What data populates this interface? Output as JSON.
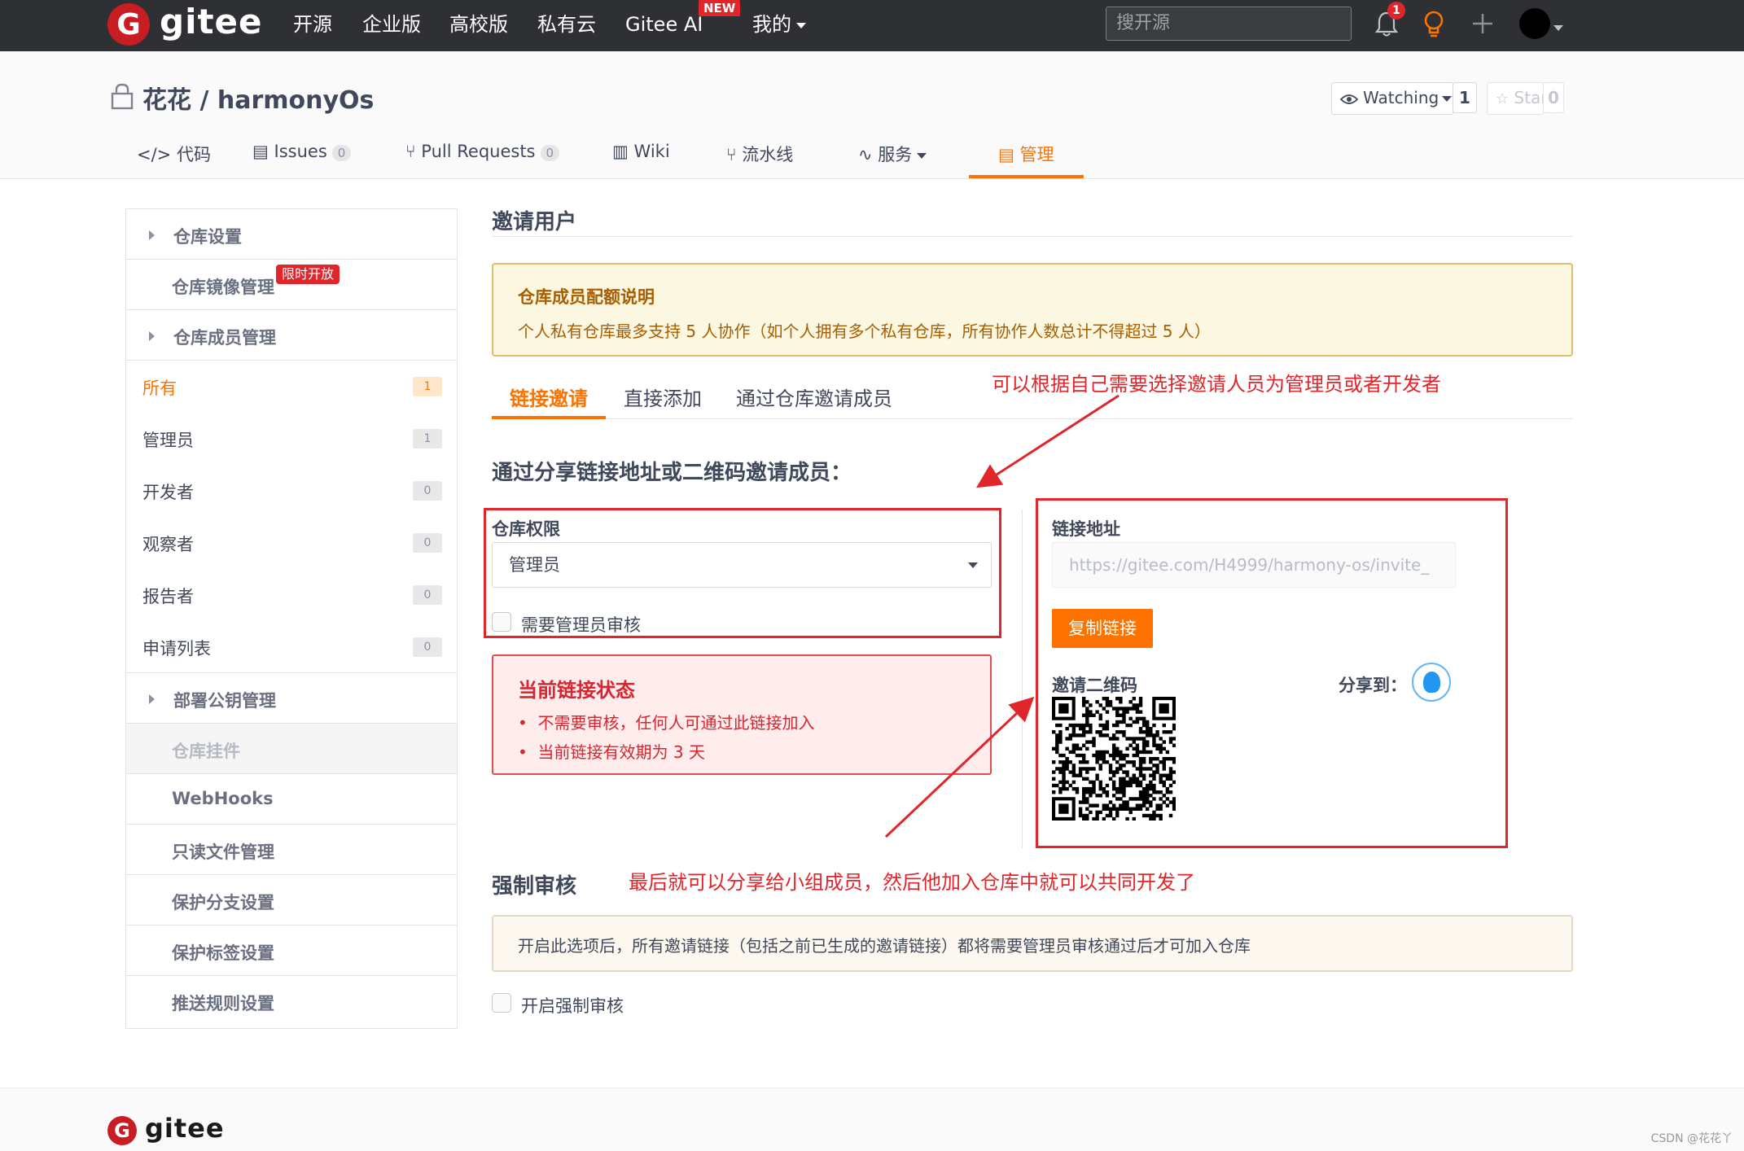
{
  "topnav": {
    "logo_letter": "G",
    "logo_text": "gitee",
    "items": [
      "开源",
      "企业版",
      "高校版",
      "私有云",
      "Gitee AI",
      "我的"
    ],
    "new_badge": "NEW",
    "search_placeholder": "搜开源",
    "notification_count": "1"
  },
  "repo": {
    "title": "花花 / harmonyOs",
    "watching_label": "Watching",
    "watching_count": "1",
    "star_label": "Star",
    "star_count": "0"
  },
  "tabs": [
    {
      "label": "代码"
    },
    {
      "label": "Issues",
      "count": "0"
    },
    {
      "label": "Pull Requests",
      "count": "0"
    },
    {
      "label": "Wiki"
    },
    {
      "label": "流水线"
    },
    {
      "label": "服务"
    },
    {
      "label": "管理"
    }
  ],
  "sidebar": {
    "repo_settings": "仓库设置",
    "mirror_manage": "仓库镜像管理",
    "limited_badge": "限时开放",
    "member_manage": "仓库成员管理",
    "filters": [
      {
        "label": "所有",
        "count": "1"
      },
      {
        "label": "管理员",
        "count": "1"
      },
      {
        "label": "开发者",
        "count": "0"
      },
      {
        "label": "观察者",
        "count": "0"
      },
      {
        "label": "报告者",
        "count": "0"
      },
      {
        "label": "申请列表",
        "count": "0"
      }
    ],
    "deploy_keys": "部署公钥管理",
    "repo_widget": "仓库挂件",
    "webhooks": "WebHooks",
    "readonly_files": "只读文件管理",
    "protected_branch": "保护分支设置",
    "protected_tag": "保护标签设置",
    "push_rules": "推送规则设置"
  },
  "main": {
    "title": "邀请用户",
    "notice_title": "仓库成员配额说明",
    "notice_text": "个人私有仓库最多支持 5 人协作（如个人拥有多个私有仓库，所有协作人数总计不得超过 5 人）",
    "subtabs": [
      "链接邀请",
      "直接添加",
      "通过仓库邀请成员"
    ],
    "annotation_top": "可以根据自己需要选择邀请人员为管理员或者开发者",
    "share_heading": "通过分享链接地址或二维码邀请成员：",
    "permission_label": "仓库权限",
    "permission_value": "管理员",
    "need_review_label": "需要管理员审核",
    "status_title": "当前链接状态",
    "status_items": [
      "不需要审核，任何人可通过此链接加入",
      "当前链接有效期为 3 天"
    ],
    "link_label": "链接地址",
    "link_value": "https://gitee.com/H4999/harmony-os/invite_",
    "copy_button": "复制链接",
    "qr_label": "邀请二维码",
    "share_to": "分享到：",
    "force_title": "强制审核",
    "annotation_bottom": "最后就可以分享给小组成员，然后他加入仓库中就可以共同开发了",
    "force_text": "开启此选项后，所有邀请链接（包括之前已生成的邀请链接）都将需要管理员审核通过后才可加入仓库",
    "force_checkbox_label": "开启强制审核"
  },
  "footer": {
    "logo_letter": "G",
    "logo_text": "gitee"
  },
  "watermark": "CSDN @花花丫",
  "colors": {
    "accent": "#fe7300",
    "nav_bg": "#2e3033",
    "brand_red": "#c71d23",
    "annotation_red": "#e0262b"
  }
}
